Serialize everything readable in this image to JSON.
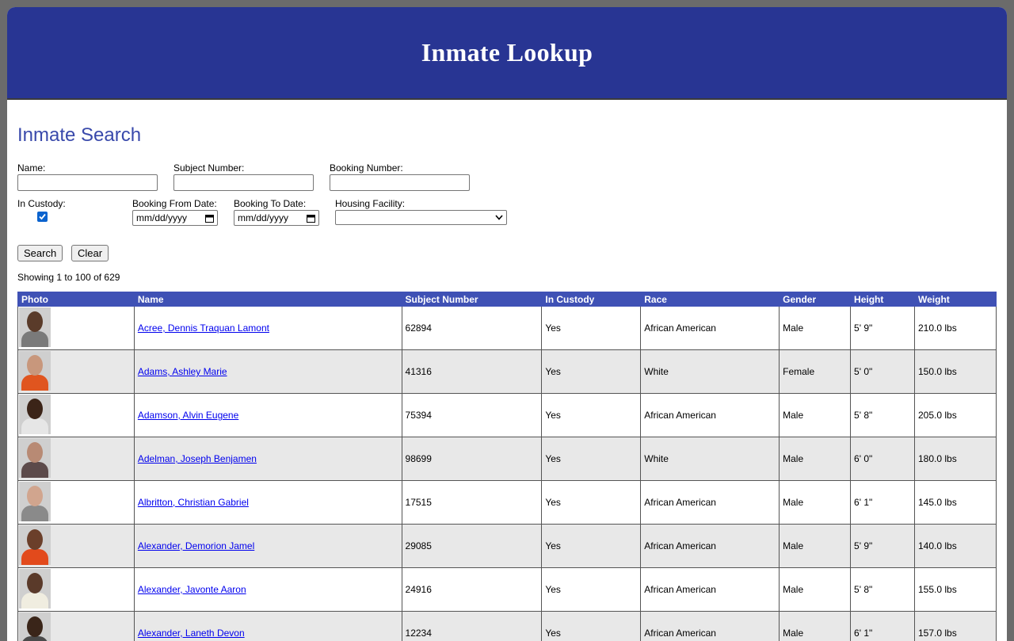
{
  "header": {
    "title": "Inmate Lookup"
  },
  "search": {
    "title": "Inmate Search",
    "name_label": "Name:",
    "subject_label": "Subject Number:",
    "booking_label": "Booking Number:",
    "custody_label": "In Custody:",
    "custody_checked": true,
    "from_label": "Booking From Date:",
    "to_label": "Booking To Date:",
    "date_placeholder": "mm/dd/yyyy",
    "housing_label": "Housing Facility:",
    "housing_value": "",
    "search_button": "Search",
    "clear_button": "Clear"
  },
  "results": {
    "showing": "Showing 1 to 100 of 629",
    "columns": [
      "Photo",
      "Name",
      "Subject Number",
      "In Custody",
      "Race",
      "Gender",
      "Height",
      "Weight"
    ],
    "rows": [
      {
        "name": "Acree, Dennis Traquan Lamont",
        "subject": "62894",
        "custody": "Yes",
        "race": "African American",
        "gender": "Male",
        "height": "5' 9\"",
        "weight": "210.0 lbs",
        "skin": "#5a3b2a",
        "shirt": "#7a7a7a"
      },
      {
        "name": "Adams, Ashley Marie",
        "subject": "41316",
        "custody": "Yes",
        "race": "White",
        "gender": "Female",
        "height": "5' 0\"",
        "weight": "150.0 lbs",
        "skin": "#c8977c",
        "shirt": "#e0551f"
      },
      {
        "name": "Adamson, Alvin Eugene",
        "subject": "75394",
        "custody": "Yes",
        "race": "African American",
        "gender": "Male",
        "height": "5' 8\"",
        "weight": "205.0 lbs",
        "skin": "#3b2418",
        "shirt": "#e6e6e6"
      },
      {
        "name": "Adelman, Joseph Benjamen",
        "subject": "98699",
        "custody": "Yes",
        "race": "White",
        "gender": "Male",
        "height": "6' 0\"",
        "weight": "180.0 lbs",
        "skin": "#b88a74",
        "shirt": "#5c4a4a"
      },
      {
        "name": "Albritton, Christian Gabriel",
        "subject": "17515",
        "custody": "Yes",
        "race": "African American",
        "gender": "Male",
        "height": "6' 1\"",
        "weight": "145.0 lbs",
        "skin": "#d1a58e",
        "shirt": "#8a8a8a"
      },
      {
        "name": "Alexander, Demorion Jamel",
        "subject": "29085",
        "custody": "Yes",
        "race": "African American",
        "gender": "Male",
        "height": "5' 9\"",
        "weight": "140.0 lbs",
        "skin": "#6b3f2a",
        "shirt": "#e24a1c"
      },
      {
        "name": "Alexander, Javonte Aaron",
        "subject": "24916",
        "custody": "Yes",
        "race": "African American",
        "gender": "Male",
        "height": "5' 8\"",
        "weight": "155.0 lbs",
        "skin": "#5a3a2a",
        "shirt": "#f0ede0"
      },
      {
        "name": "Alexander, Laneth Devon",
        "subject": "12234",
        "custody": "Yes",
        "race": "African American",
        "gender": "Male",
        "height": "6' 1\"",
        "weight": "157.0 lbs",
        "skin": "#3a2519",
        "shirt": "#4a4a4a"
      }
    ]
  }
}
